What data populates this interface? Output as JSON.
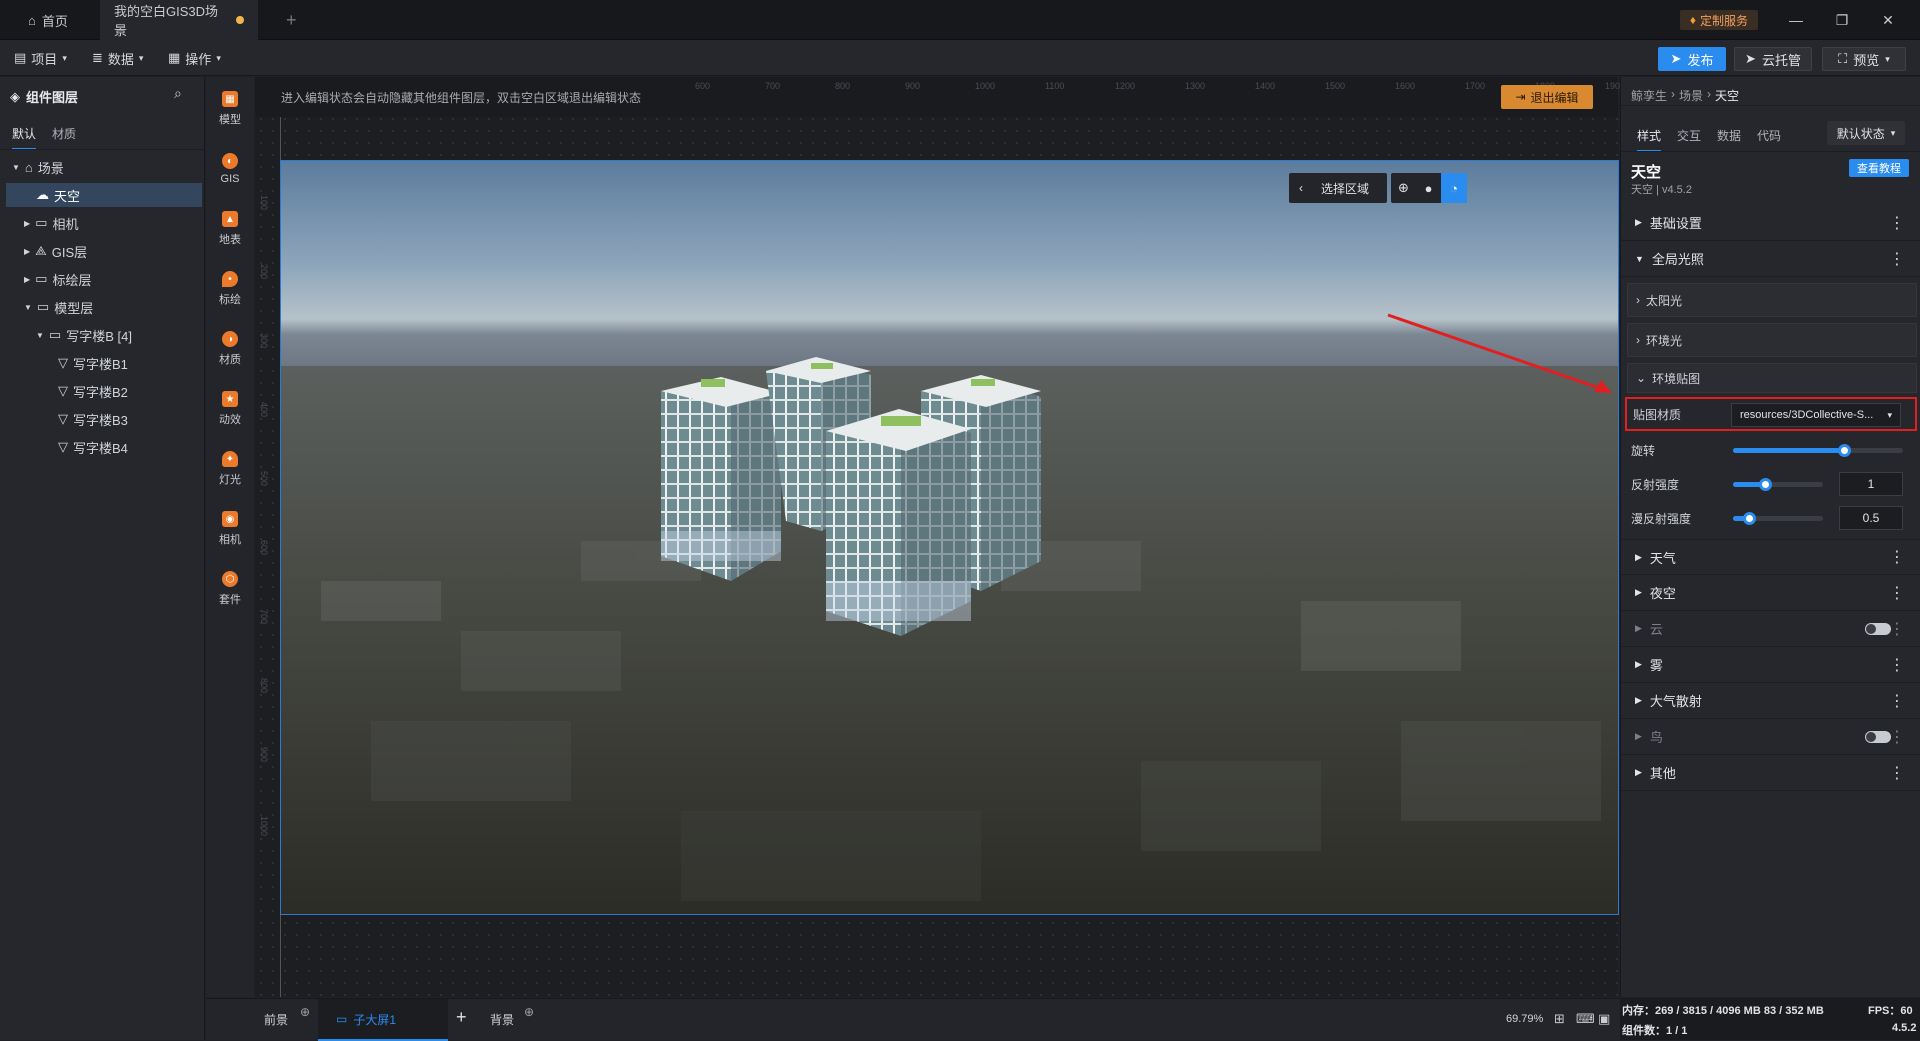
{
  "titlebar": {
    "tabs": [
      {
        "label": "首页",
        "icon": "home-icon"
      },
      {
        "label": "我的空白GIS3D场景",
        "unsaved": true
      }
    ],
    "add_tab": "+",
    "custom_service": "定制服务",
    "window_controls": [
      "minimize-icon",
      "restore-icon",
      "close-icon"
    ]
  },
  "menubar": {
    "menus": [
      "项目",
      "数据",
      "操作"
    ],
    "publish": "发布",
    "cloud_hosting": "云托管",
    "preview": "预览"
  },
  "left_panel": {
    "title": "组件图层",
    "tabs": [
      "默认",
      "材质"
    ],
    "tree": [
      {
        "label": "场景",
        "level": 0,
        "expanded": true,
        "icon": "scene-icon"
      },
      {
        "label": "天空",
        "level": 1,
        "selected": true,
        "icon": "sky-icon"
      },
      {
        "label": "相机",
        "level": 1,
        "icon": "folder-icon"
      },
      {
        "label": "GIS层",
        "level": 1,
        "icon": "gis-layer-icon"
      },
      {
        "label": "标绘层",
        "level": 1,
        "icon": "folder-icon"
      },
      {
        "label": "模型层",
        "level": 1,
        "expanded": true,
        "icon": "folder-icon"
      },
      {
        "label": "写字楼B [4]",
        "level": 2,
        "expanded": true,
        "icon": "folder-icon"
      },
      {
        "label": "写字楼B1",
        "level": 3,
        "icon": "model-icon"
      },
      {
        "label": "写字楼B2",
        "level": 3,
        "icon": "model-icon"
      },
      {
        "label": "写字楼B3",
        "level": 3,
        "icon": "model-icon"
      },
      {
        "label": "写字楼B4",
        "level": 3,
        "icon": "model-icon"
      }
    ]
  },
  "tools": [
    {
      "label": "模型",
      "icon": "model-tool-icon"
    },
    {
      "label": "GIS",
      "icon": "gis-tool-icon"
    },
    {
      "label": "地表",
      "icon": "terrain-tool-icon"
    },
    {
      "label": "标绘",
      "icon": "marker-tool-icon"
    },
    {
      "label": "材质",
      "icon": "material-tool-icon"
    },
    {
      "label": "动效",
      "icon": "effect-tool-icon"
    },
    {
      "label": "灯光",
      "icon": "light-tool-icon"
    },
    {
      "label": "相机",
      "icon": "camera-tool-icon"
    },
    {
      "label": "套件",
      "icon": "kit-tool-icon"
    }
  ],
  "canvas": {
    "hint": "进入编辑状态会自动隐藏其他组件图层，双击空白区域退出编辑状态",
    "exit_edit": "退出编辑",
    "select_area": "选择区域",
    "ruler_top": [
      "600",
      "700",
      "800",
      "900",
      "1000",
      "1100",
      "1200",
      "1300",
      "1400",
      "1500",
      "1600",
      "1700",
      "1800",
      "1900"
    ],
    "ruler_left": [
      "100",
      "200",
      "300",
      "400",
      "500",
      "600",
      "700",
      "800",
      "900",
      "1000"
    ]
  },
  "right_panel": {
    "breadcrumb": [
      "鲸孪生",
      "场景",
      "天空"
    ],
    "tabs": [
      "样式",
      "交互",
      "数据",
      "代码"
    ],
    "state_select": "默认状态",
    "component_title": "天空",
    "component_version": "天空 | v4.5.2",
    "tutorial": "查看教程",
    "sections": {
      "basic": "基础设置",
      "global_light": "全局光照",
      "sunlight": "太阳光",
      "ambient": "环境光",
      "env_map": "环境贴图",
      "texture_label": "贴图材质",
      "texture_value": "resources/3DCollective-S...",
      "rotation_label": "旋转",
      "rotation_value": 0.65,
      "reflect_label": "反射强度",
      "reflect_value": "1",
      "reflect_fraction": 0.35,
      "diffuse_label": "漫反射强度",
      "diffuse_value": "0.5",
      "diffuse_fraction": 0.18,
      "weather": "天气",
      "night": "夜空",
      "cloud": "云",
      "fog": "雾",
      "atmosphere": "大气散射",
      "bird": "鸟",
      "other": "其他"
    }
  },
  "bottombar": {
    "front": "前景",
    "child_screen": "子大屏1",
    "add": "+",
    "background": "背景",
    "zoom": "69.79%"
  },
  "status": {
    "memory": "内存：269 / 3815 / 4096 MB  83 / 352 MB",
    "fps": "FPS：60",
    "components": "组件数：1 / 1",
    "version": "4.5.2"
  },
  "colors": {
    "accent": "#2b8cf0",
    "orange": "#ec7a2c",
    "highlight": "#e02020"
  }
}
